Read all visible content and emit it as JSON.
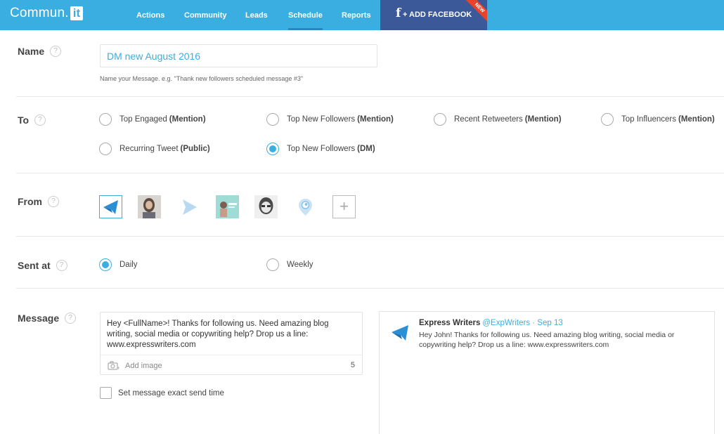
{
  "app": {
    "logo_text": "Commun.",
    "logo_box": "it"
  },
  "nav": {
    "actions": "Actions",
    "community": "Community",
    "leads": "Leads",
    "schedule": "Schedule",
    "reports": "Reports"
  },
  "facebook": {
    "icon": "f",
    "plus": "+",
    "label": "ADD FACEBOOK",
    "badge": "NEW"
  },
  "help": "?",
  "name_section": {
    "label": "Name",
    "value": "DM new August 2016",
    "hint": "Name your Message. e.g. \"Thank new followers scheduled message #3\""
  },
  "to_section": {
    "label": "To",
    "options": [
      {
        "text": "Top Engaged",
        "bold": "(Mention)",
        "selected": false
      },
      {
        "text": "Top New Followers",
        "bold": "(Mention)",
        "selected": false
      },
      {
        "text": "Recent Retweeters",
        "bold": "(Mention)",
        "selected": false
      },
      {
        "text": "Top Influencers",
        "bold": "(Mention)",
        "selected": false
      },
      {
        "text": "Recurring Tweet",
        "bold": "(Public)",
        "selected": false
      },
      {
        "text": "Top New Followers",
        "bold": "(DM)",
        "selected": true
      }
    ]
  },
  "from_section": {
    "label": "From",
    "add": "+"
  },
  "sent_section": {
    "label": "Sent at",
    "options": [
      {
        "text": "Daily",
        "selected": true
      },
      {
        "text": "Weekly",
        "selected": false
      }
    ]
  },
  "message_section": {
    "label": "Message",
    "text": "Hey <FullName>! Thanks for following us. Need amazing blog writing, social media or copywriting help? Drop us a line: www.expresswriters.com",
    "add_image": "Add image",
    "char_count": "5",
    "exact_time": "Set message exact send time"
  },
  "preview": {
    "name": "Express Writers",
    "handle": "@ExpWriters · Sep 13",
    "text": "Hey John! Thanks for following us. Need amazing blog writing, social media or copywriting help? Drop us a line: www.expresswriters.com"
  },
  "colors": {
    "brand": "#3aaee0",
    "facebook": "#3b5998",
    "badge": "#e8432a"
  }
}
